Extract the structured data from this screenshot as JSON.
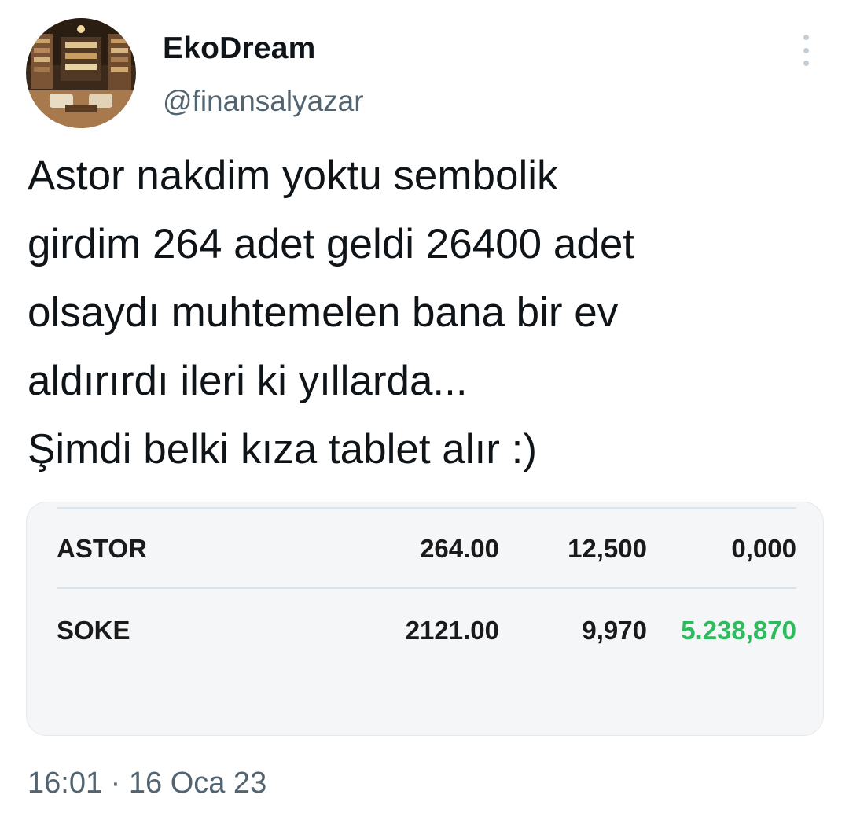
{
  "author": {
    "display_name": "EkoDream",
    "username": "@finansalyazar",
    "avatar_icon": "library-room-photo-avatar"
  },
  "tweet": {
    "lines": [
      "Astor nakdim yoktu sembolik",
      "girdim 264 adet geldi 26400 adet",
      "olsaydı muhtemelen bana bir ev",
      "aldırırdı ileri ki yıllarda...",
      "Şimdi belki kıza tablet alır :)"
    ],
    "timestamp": "16:01 · 16 Oca 23"
  },
  "portfolio": {
    "rows": [
      {
        "symbol": "ASTOR",
        "price": "264.00",
        "quantity": "12,500",
        "value": "0,000",
        "value_positive": false
      },
      {
        "symbol": "SOKE",
        "price": "2121.00",
        "quantity": "9,970",
        "value": "5.238,870",
        "value_positive": true
      }
    ],
    "gain_color": "#2dbb5d"
  },
  "colors": {
    "text_primary": "#0f1419",
    "text_secondary": "#536471"
  },
  "icons": {
    "more": "more-vertical-icon"
  }
}
